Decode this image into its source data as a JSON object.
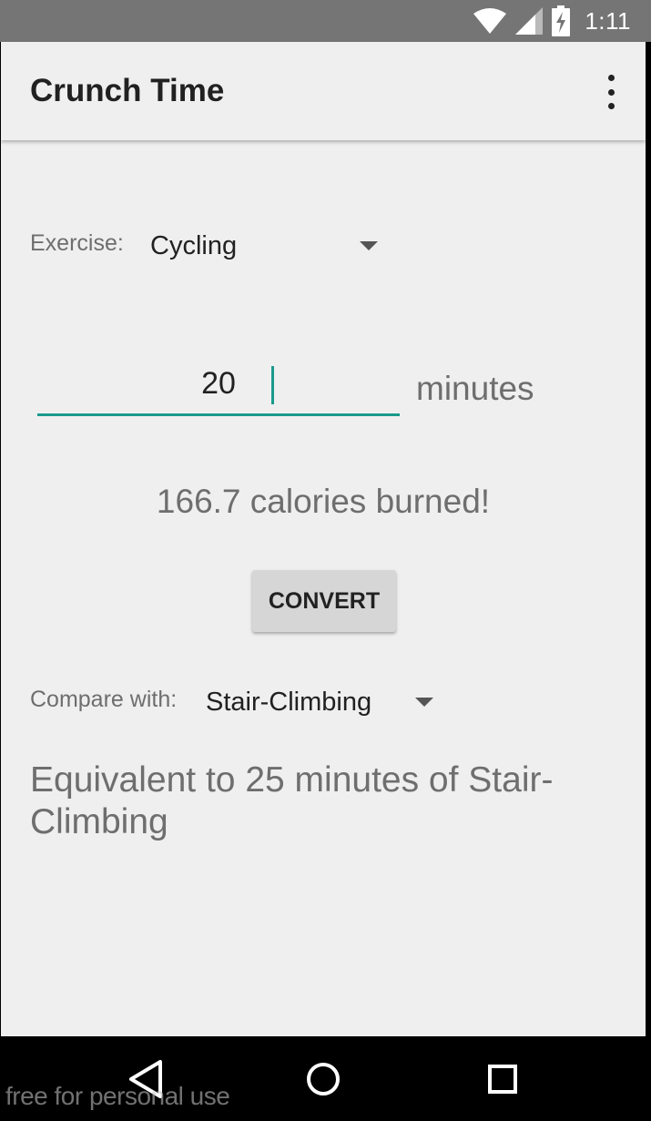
{
  "status_bar": {
    "time": "1:11",
    "icons": [
      "wifi-icon",
      "cell-signal-icon",
      "battery-charging-icon"
    ]
  },
  "app_bar": {
    "title": "Crunch Time",
    "menu_icon": "overflow-menu-icon"
  },
  "exercise": {
    "label": "Exercise:",
    "selected": "Cycling"
  },
  "duration": {
    "value": "20",
    "unit": "minutes"
  },
  "result_text": "166.7 calories burned!",
  "convert_button_label": "CONVERT",
  "compare": {
    "label": "Compare with:",
    "selected": "Stair-Climbing"
  },
  "equivalent_text": "Equivalent to 25 minutes of Stair-Climbing",
  "nav_bar": {
    "icons": [
      "back-icon",
      "home-icon",
      "recents-icon"
    ]
  },
  "watermark": "free for personal use",
  "colors": {
    "accent": "#1a9a8c",
    "status_bar": "#757575",
    "background": "#efefef"
  }
}
